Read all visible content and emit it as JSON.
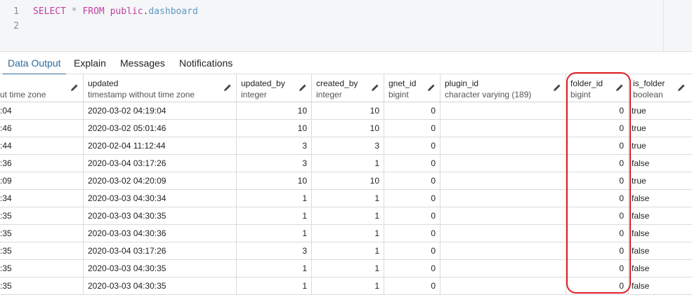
{
  "editor": {
    "lines": [
      {
        "no": "1",
        "kw_select": "SELECT",
        "star": "*",
        "kw_from": "FROM",
        "schema": "public",
        "dot": ".",
        "table": "dashboard"
      },
      {
        "no": "2"
      }
    ]
  },
  "tabs": [
    "Data Output",
    "Explain",
    "Messages",
    "Notifications"
  ],
  "columns": [
    {
      "name": "",
      "type": "ut time zone"
    },
    {
      "name": "updated",
      "type": "timestamp without time zone"
    },
    {
      "name": "updated_by",
      "type": "integer"
    },
    {
      "name": "created_by",
      "type": "integer"
    },
    {
      "name": "gnet_id",
      "type": "bigint"
    },
    {
      "name": "plugin_id",
      "type": "character varying (189)"
    },
    {
      "name": "folder_id",
      "type": "bigint"
    },
    {
      "name": "is_folder",
      "type": "boolean"
    }
  ],
  "rows": [
    [
      ":04",
      "2020-03-02 04:19:04",
      "10",
      "10",
      "0",
      "",
      "0",
      "true"
    ],
    [
      ":46",
      "2020-03-02 05:01:46",
      "10",
      "10",
      "0",
      "",
      "0",
      "true"
    ],
    [
      ":44",
      "2020-02-04 11:12:44",
      "3",
      "3",
      "0",
      "",
      "0",
      "true"
    ],
    [
      ":36",
      "2020-03-04 03:17:26",
      "3",
      "1",
      "0",
      "",
      "0",
      "false"
    ],
    [
      ":09",
      "2020-03-02 04:20:09",
      "10",
      "10",
      "0",
      "",
      "0",
      "true"
    ],
    [
      ":34",
      "2020-03-03 04:30:34",
      "1",
      "1",
      "0",
      "",
      "0",
      "false"
    ],
    [
      ":35",
      "2020-03-03 04:30:35",
      "1",
      "1",
      "0",
      "",
      "0",
      "false"
    ],
    [
      ":35",
      "2020-03-03 04:30:36",
      "1",
      "1",
      "0",
      "",
      "0",
      "false"
    ],
    [
      ":35",
      "2020-03-04 03:17:26",
      "3",
      "1",
      "0",
      "",
      "0",
      "false"
    ],
    [
      ":35",
      "2020-03-03 04:30:35",
      "1",
      "1",
      "0",
      "",
      "0",
      "false"
    ],
    [
      ":35",
      "2020-03-03 04:30:35",
      "1",
      "1",
      "0",
      "",
      "0",
      "false"
    ]
  ],
  "icons": {
    "edit": "pencil-icon"
  },
  "colors": {
    "accent": "#2c6ba0",
    "highlight": "#e31f25",
    "keyword": "#c23ea3",
    "table_name": "#5b9ac2"
  }
}
